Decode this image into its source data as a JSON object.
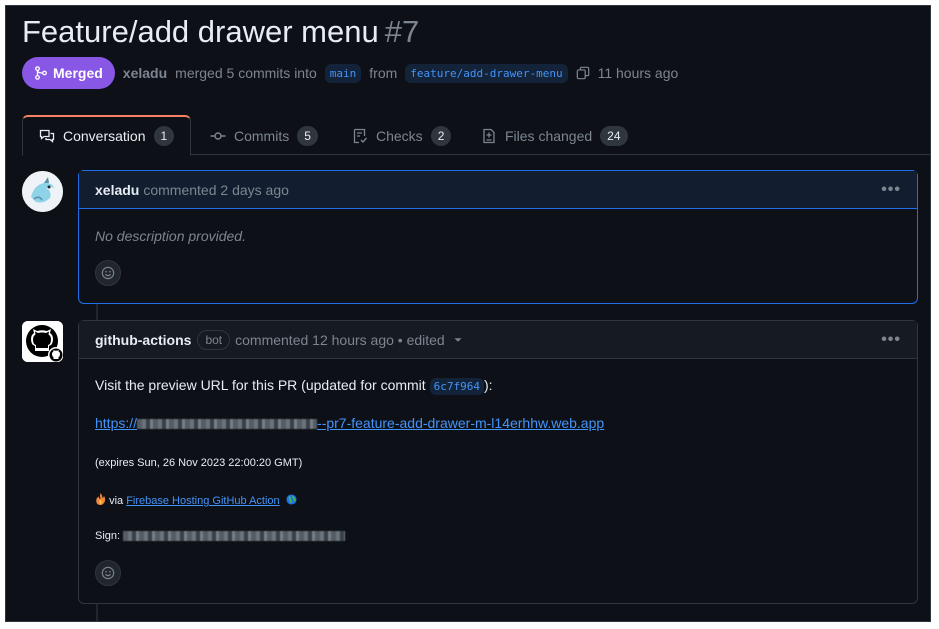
{
  "pr": {
    "title": "Feature/add drawer menu",
    "number": "#7",
    "state_label": "Merged",
    "author": "xeladu",
    "merge_text": "merged 5 commits into",
    "base_branch": "main",
    "from_text": "from",
    "head_branch": "feature/add-drawer-menu",
    "time": "11 hours ago"
  },
  "tabs": [
    {
      "label": "Conversation",
      "count": "1",
      "icon": "comment-discussion-icon"
    },
    {
      "label": "Commits",
      "count": "5",
      "icon": "git-commit-icon"
    },
    {
      "label": "Checks",
      "count": "2",
      "icon": "checklist-icon"
    },
    {
      "label": "Files changed",
      "count": "24",
      "icon": "file-diff-icon"
    }
  ],
  "comment1": {
    "author": "xeladu",
    "meta": "commented 2 days ago",
    "body": "No description provided."
  },
  "comment2": {
    "author": "github-actions",
    "bot_label": "bot",
    "meta": "commented 12 hours ago • edited",
    "line1_prefix": "Visit the preview URL for this PR (updated for commit",
    "commit_sha": "6c7f964",
    "line1_suffix": "):",
    "url_prefix": "https://",
    "url_suffix": "--pr7-feature-add-drawer-m-l14erhhw.web.app",
    "expires": "(expires Sun, 26 Nov 2023 22:00:20 GMT)",
    "via_text": "via",
    "action_link": "Firebase Hosting GitHub Action",
    "sign_label": "Sign:"
  },
  "colors": {
    "merged": "#8957e5",
    "link": "#4493f8",
    "tab_active_border": "#f78166",
    "background": "#0d1117"
  }
}
